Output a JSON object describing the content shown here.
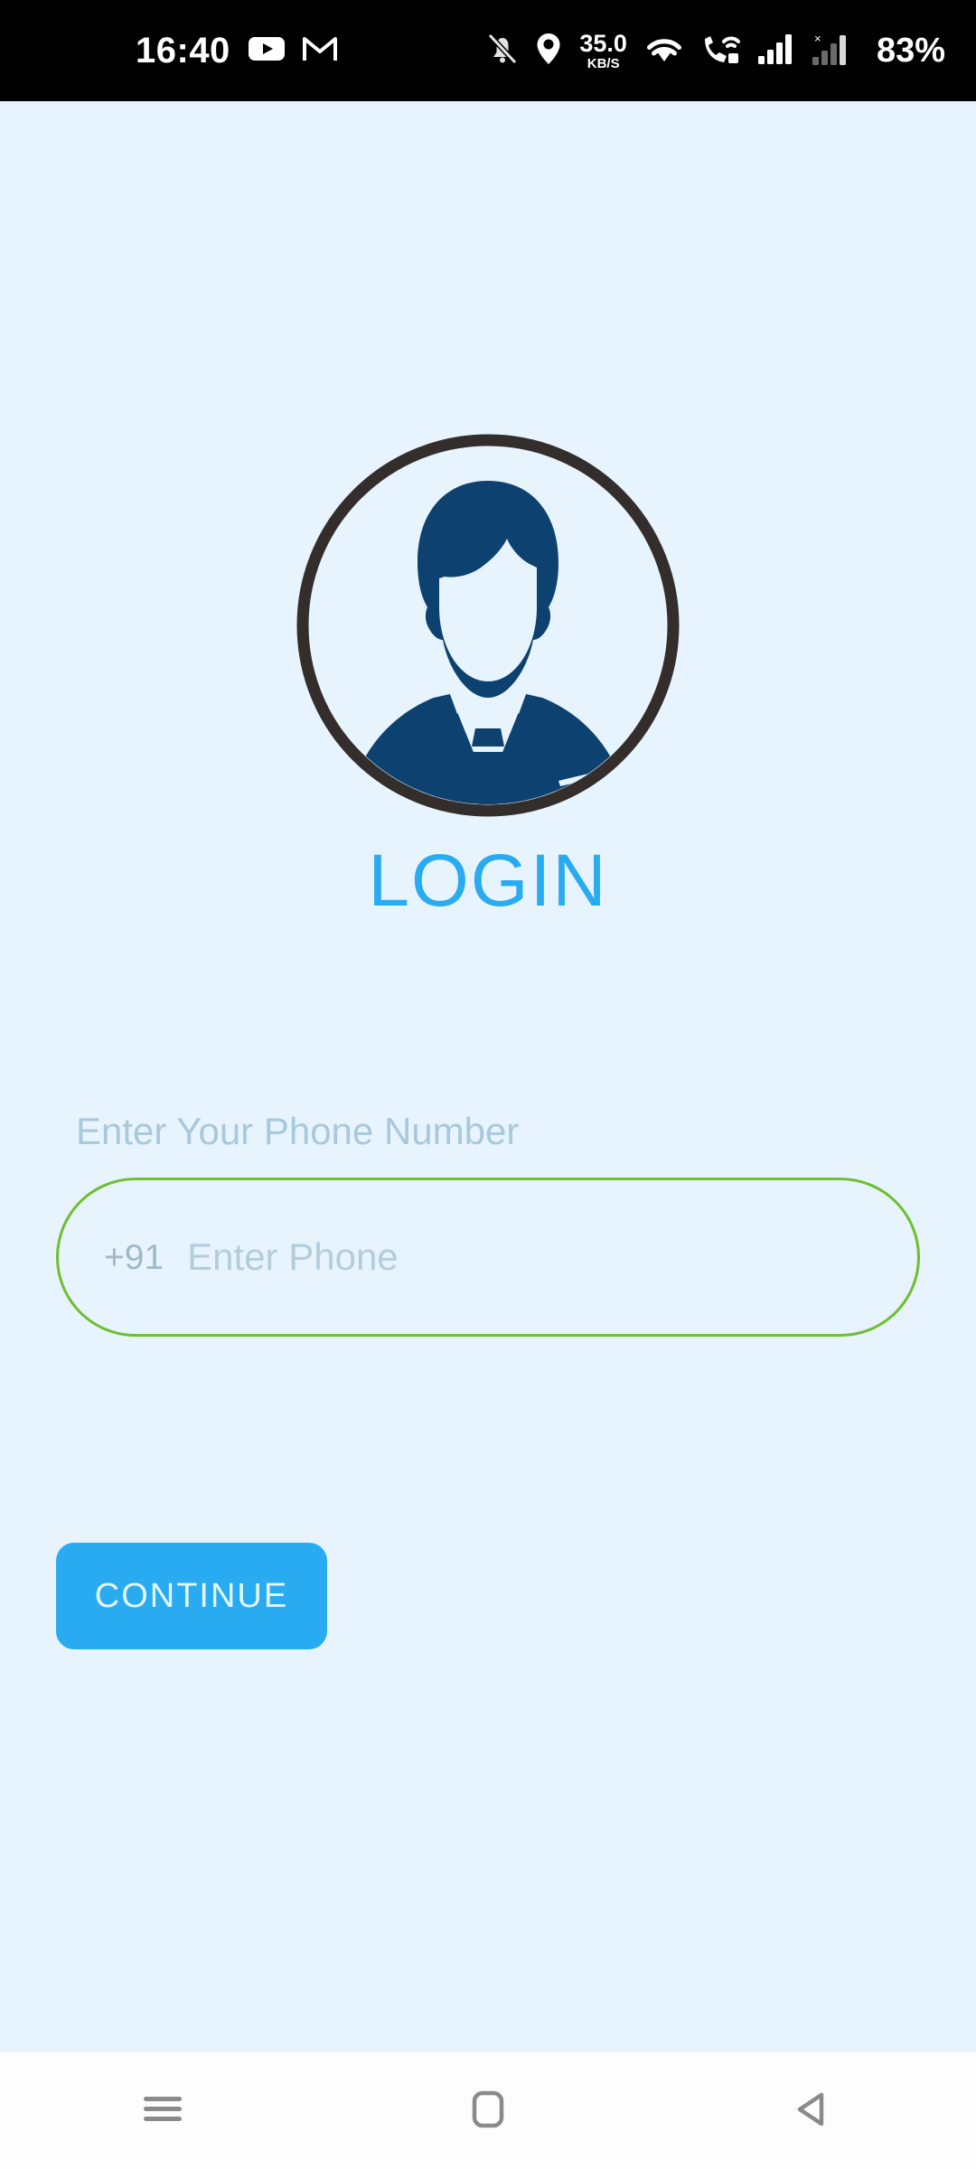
{
  "status_bar": {
    "clock": "16:40",
    "network_speed_value": "35.0",
    "network_speed_unit": "KB/S",
    "battery_percent": "83%",
    "left_icons": [
      "youtube-icon",
      "gmail-icon"
    ],
    "right_icons": [
      "bell-off-icon",
      "location-pin-icon",
      "wifi-icon",
      "wifi-calling-icon",
      "signal-bars-icon",
      "signal-no-sim-icon"
    ],
    "background_color": "#000000",
    "text_color": "#ffffff"
  },
  "screen": {
    "background_color": "#e8f4fd",
    "accent_color": "#29ABF2",
    "input_border_color": "#6fbf2f",
    "avatar_color": "#0d4270",
    "avatar_ring_color": "#332e2c"
  },
  "logo": {
    "icon_name": "user-avatar-businessman-icon"
  },
  "header": {
    "title": "LOGIN"
  },
  "form": {
    "phone_label": "Enter Your Phone Number",
    "country_code": "+91",
    "phone_placeholder": "Enter Phone",
    "phone_value": "",
    "submit_label": "CONTINUE"
  },
  "nav_bar": {
    "recents_icon": "hamburger-recents-icon",
    "home_icon": "home-square-icon",
    "back_icon": "back-triangle-icon",
    "background_color": "#fdfdfd",
    "icon_color": "#8a8a8a"
  }
}
